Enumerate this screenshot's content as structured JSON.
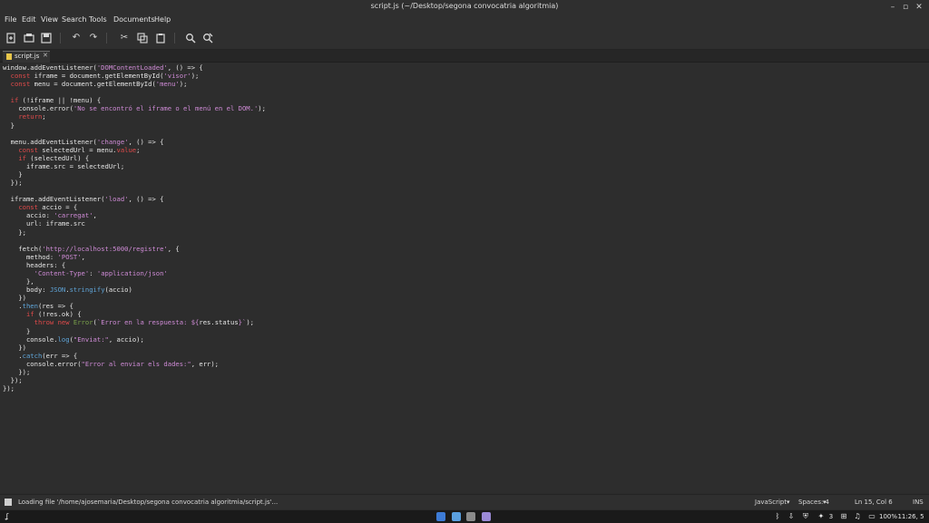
{
  "window": {
    "title": "script.js (~/Desktop/segona convocatria algoritmia)"
  },
  "menu": [
    "File",
    "Edit",
    "View",
    "Search",
    "Tools",
    "Documents",
    "Help"
  ],
  "tab": {
    "label": "script.js"
  },
  "code_lines": [
    [
      {
        "t": "window.addEventListener("
      },
      {
        "t": "'DOMContentLoaded'",
        "c": "st"
      },
      {
        "t": ", () => {"
      }
    ],
    [
      {
        "t": "  "
      },
      {
        "t": "const",
        "c": "kw"
      },
      {
        "t": " iframe = document.getElementById("
      },
      {
        "t": "'visor'",
        "c": "st"
      },
      {
        "t": ");"
      }
    ],
    [
      {
        "t": "  "
      },
      {
        "t": "const",
        "c": "kw"
      },
      {
        "t": " menu = document.getElementById("
      },
      {
        "t": "'menu'",
        "c": "st"
      },
      {
        "t": ");"
      }
    ],
    [
      {
        "t": ""
      }
    ],
    [
      {
        "t": "  "
      },
      {
        "t": "if",
        "c": "kw"
      },
      {
        "t": " (!iframe || !menu) {"
      }
    ],
    [
      {
        "t": "    console.error("
      },
      {
        "t": "'No se encontró el iframe o el menú en el DOM.'",
        "c": "st"
      },
      {
        "t": ");"
      }
    ],
    [
      {
        "t": "    "
      },
      {
        "t": "return",
        "c": "kw"
      },
      {
        "t": ";"
      }
    ],
    [
      {
        "t": "  }"
      }
    ],
    [
      {
        "t": ""
      }
    ],
    [
      {
        "t": "  menu.addEventListener("
      },
      {
        "t": "'change'",
        "c": "st"
      },
      {
        "t": ", () => {"
      }
    ],
    [
      {
        "t": "    "
      },
      {
        "t": "const",
        "c": "kw"
      },
      {
        "t": " selectedUrl = menu."
      },
      {
        "t": "value",
        "c": "kw"
      },
      {
        "t": ";"
      }
    ],
    [
      {
        "t": "    "
      },
      {
        "t": "if",
        "c": "kw"
      },
      {
        "t": " (selectedUrl) {"
      }
    ],
    [
      {
        "t": "      iframe.src = selectedUrl;"
      }
    ],
    [
      {
        "t": "    }"
      }
    ],
    [
      {
        "t": "  });"
      }
    ],
    [
      {
        "t": ""
      }
    ],
    [
      {
        "t": "  iframe.addEventListener("
      },
      {
        "t": "'load'",
        "c": "st"
      },
      {
        "t": ", () => {"
      }
    ],
    [
      {
        "t": "    "
      },
      {
        "t": "const",
        "c": "kw"
      },
      {
        "t": " accio = {"
      }
    ],
    [
      {
        "t": "      accio: "
      },
      {
        "t": "'carregat'",
        "c": "st"
      },
      {
        "t": ","
      }
    ],
    [
      {
        "t": "      url: iframe.src"
      }
    ],
    [
      {
        "t": "    };"
      }
    ],
    [
      {
        "t": ""
      }
    ],
    [
      {
        "t": "    fetch("
      },
      {
        "t": "'http://localhost:5000/registre'",
        "c": "st"
      },
      {
        "t": ", {"
      }
    ],
    [
      {
        "t": "      method: "
      },
      {
        "t": "'POST'",
        "c": "st"
      },
      {
        "t": ","
      }
    ],
    [
      {
        "t": "      headers: {"
      }
    ],
    [
      {
        "t": "        "
      },
      {
        "t": "'Content-Type'",
        "c": "st"
      },
      {
        "t": ": "
      },
      {
        "t": "'application/json'",
        "c": "st"
      }
    ],
    [
      {
        "t": "      },"
      }
    ],
    [
      {
        "t": "      body: "
      },
      {
        "t": "JSON",
        "c": "fn"
      },
      {
        "t": "."
      },
      {
        "t": "stringify",
        "c": "fn"
      },
      {
        "t": "(accio)"
      }
    ],
    [
      {
        "t": "    })"
      }
    ],
    [
      {
        "t": "    ."
      },
      {
        "t": "then",
        "c": "fn"
      },
      {
        "t": "(res => {"
      }
    ],
    [
      {
        "t": "      "
      },
      {
        "t": "if",
        "c": "kw"
      },
      {
        "t": " (!res.ok) {"
      }
    ],
    [
      {
        "t": "        "
      },
      {
        "t": "throw",
        "c": "kw"
      },
      {
        "t": " "
      },
      {
        "t": "new",
        "c": "kw"
      },
      {
        "t": " "
      },
      {
        "t": "Error",
        "c": "cl"
      },
      {
        "t": "("
      },
      {
        "t": "`Error en la respuesta: ${",
        "c": "st"
      },
      {
        "t": "res.status"
      },
      {
        "t": "}`",
        "c": "st"
      },
      {
        "t": ");"
      }
    ],
    [
      {
        "t": "      }"
      }
    ],
    [
      {
        "t": "      console."
      },
      {
        "t": "log",
        "c": "fn"
      },
      {
        "t": "("
      },
      {
        "t": "\"Enviat:\"",
        "c": "st"
      },
      {
        "t": ", accio);"
      }
    ],
    [
      {
        "t": "    })"
      }
    ],
    [
      {
        "t": "    ."
      },
      {
        "t": "catch",
        "c": "fn"
      },
      {
        "t": "(err => {"
      }
    ],
    [
      {
        "t": "      console.error("
      },
      {
        "t": "\"Error al enviar els dades:\"",
        "c": "st"
      },
      {
        "t": ", err);"
      }
    ],
    [
      {
        "t": "    });"
      }
    ],
    [
      {
        "t": "  });"
      }
    ],
    [
      {
        "t": "});"
      }
    ]
  ],
  "status": {
    "message": "Loading file '/home/ajosemaria/Desktop/segona convocatria algoritmia/script.js'...",
    "language": "JavaScript",
    "spaces": "Spaces: 4",
    "position": "Ln 15, Col 6",
    "mode": "INS"
  },
  "taskbar": {
    "tray_count": "3",
    "battery": "100%",
    "clock": "11:26, 5"
  }
}
